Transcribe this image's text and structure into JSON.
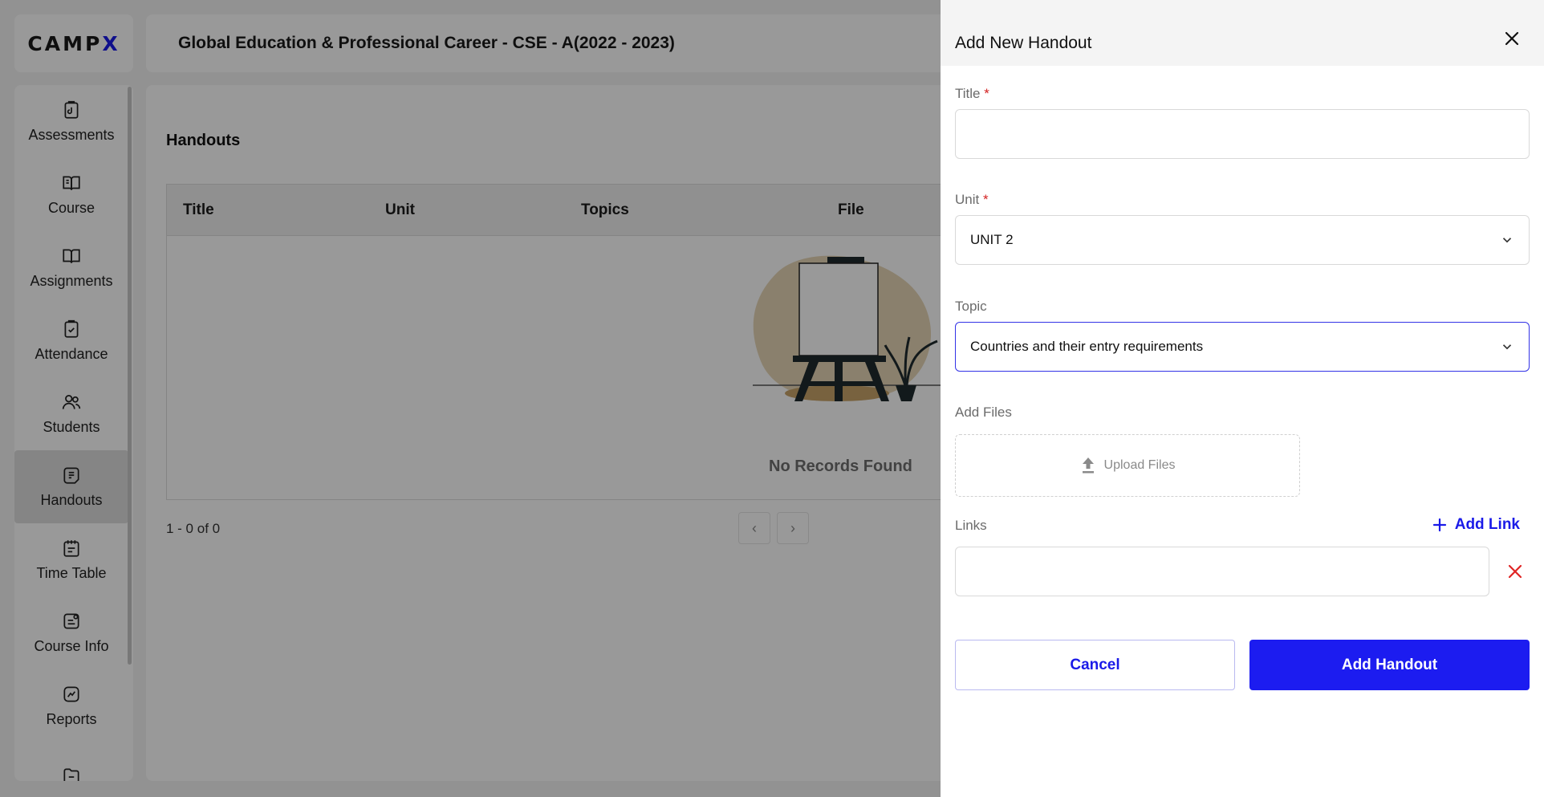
{
  "app": {
    "logo_prefix": "CAMP",
    "logo_suffix": "X"
  },
  "header": {
    "title": "Global Education & Professional Career - CSE - A(2022 - 2023)"
  },
  "sidebar": {
    "items": [
      {
        "label": "Assessments",
        "icon": "assessment-icon"
      },
      {
        "label": "Course",
        "icon": "course-book-icon"
      },
      {
        "label": "Assignments",
        "icon": "open-book-icon"
      },
      {
        "label": "Attendance",
        "icon": "clipboard-check-icon"
      },
      {
        "label": "Students",
        "icon": "users-icon"
      },
      {
        "label": "Handouts",
        "icon": "handout-icon"
      },
      {
        "label": "Time Table",
        "icon": "calendar-notes-icon"
      },
      {
        "label": "Course Info",
        "icon": "course-info-icon"
      },
      {
        "label": "Reports",
        "icon": "chart-line-icon"
      },
      {
        "label": "",
        "icon": "folder-icon"
      }
    ],
    "active": "Handouts"
  },
  "main": {
    "heading": "Handouts",
    "table": {
      "columns": [
        "Title",
        "Unit",
        "Topics",
        "File"
      ],
      "rows": []
    },
    "empty_message": "No Records Found",
    "pagination": {
      "summary": "1 - 0 of 0"
    }
  },
  "drawer": {
    "title": "Add New Handout",
    "fields": {
      "title": {
        "label": "Title",
        "value": ""
      },
      "unit": {
        "label": "Unit",
        "value": "UNIT 2"
      },
      "topic": {
        "label": "Topic",
        "value": "Countries and their entry requirements"
      },
      "files": {
        "label": "Add Files",
        "upload_label": "Upload Files"
      },
      "links": {
        "label": "Links",
        "add_label": "Add Link",
        "value": ""
      }
    },
    "buttons": {
      "cancel": "Cancel",
      "submit": "Add Handout"
    },
    "required_marker": "*"
  },
  "colors": {
    "accent": "#1c1cf0",
    "required": "#d32222",
    "overlay": "rgba(0,0,0,0.40)"
  }
}
